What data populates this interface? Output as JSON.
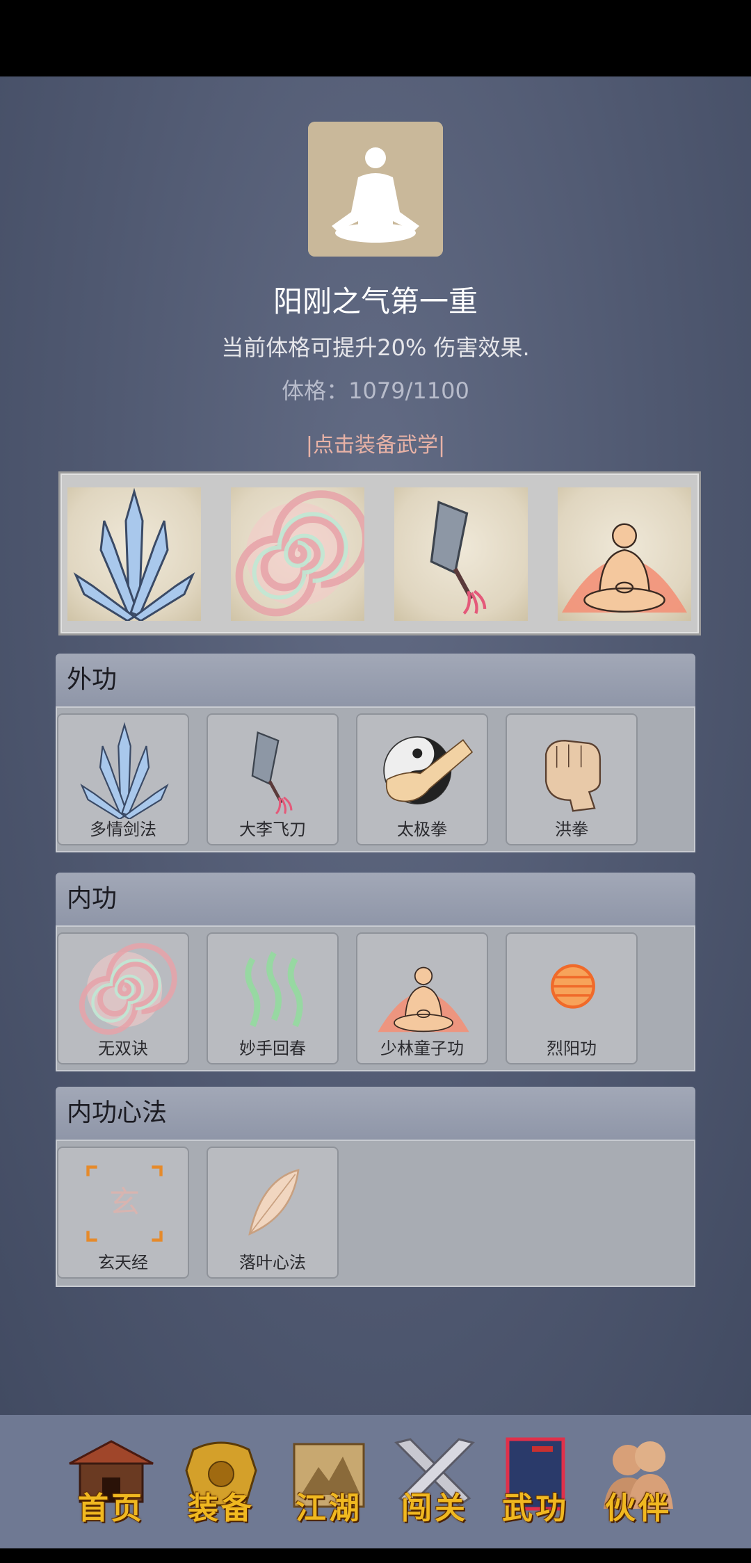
{
  "header": {
    "title": "阳刚之气第一重",
    "description": "当前体格可提升20% 伤害效果.",
    "stat_label": "体格：1079/1100",
    "equip_hint": "|点击装备武学|"
  },
  "equipped": [
    {
      "icon": "sword-fan-icon"
    },
    {
      "icon": "spiral-icon"
    },
    {
      "icon": "flying-knife-icon"
    },
    {
      "icon": "meditating-monk-icon"
    }
  ],
  "sections": {
    "waigong": {
      "title": "外功",
      "items": [
        {
          "label": "多情剑法",
          "icon": "sword-fan-icon"
        },
        {
          "label": "大李飞刀",
          "icon": "flying-knife-icon"
        },
        {
          "label": "太极拳",
          "icon": "yin-yang-fist-icon"
        },
        {
          "label": "洪拳",
          "icon": "fist-icon"
        }
      ]
    },
    "neigong": {
      "title": "内功",
      "items": [
        {
          "label": "无双诀",
          "icon": "spiral-icon"
        },
        {
          "label": "妙手回春",
          "icon": "healing-waves-icon"
        },
        {
          "label": "少林童子功",
          "icon": "meditating-monk-icon"
        },
        {
          "label": "烈阳功",
          "icon": "fire-orb-icon"
        }
      ]
    },
    "xinfa": {
      "title": "内功心法",
      "items": [
        {
          "label": "玄天经",
          "icon": "xuan-scroll-icon"
        },
        {
          "label": "落叶心法",
          "icon": "leaf-icon"
        }
      ]
    }
  },
  "nav": {
    "items": [
      {
        "label": "首页",
        "icon": "temple-icon"
      },
      {
        "label": "装备",
        "icon": "armor-icon"
      },
      {
        "label": "江湖",
        "icon": "map-scroll-icon"
      },
      {
        "label": "闯关",
        "icon": "crossed-swords-icon"
      },
      {
        "label": "武功",
        "icon": "martial-book-icon"
      },
      {
        "label": "伙伴",
        "icon": "partners-icon"
      }
    ]
  },
  "colors": {
    "background": "#4f5870",
    "hint": "#e8b2a6",
    "nav_label": "#f0b820"
  }
}
